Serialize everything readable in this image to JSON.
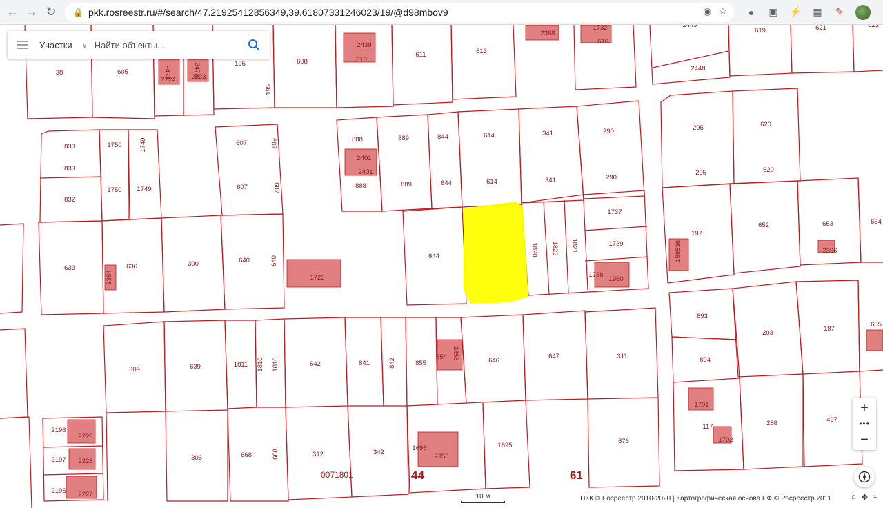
{
  "browser": {
    "url": "pkk.rosreestr.ru/#/search/47.21925412856349,39.61807331246023/19/@d98mbov9"
  },
  "search": {
    "layer_label": "Участки",
    "placeholder": "Найти объекты..."
  },
  "map": {
    "quarter_label": "0071801",
    "district_44": "44",
    "district_61": "61",
    "scale_label": "10 м",
    "copyright": "ПКК © Росреестр 2010-2020 | Картографическая основа РФ © Росреестр 2011",
    "parcel_color": "#c8161d",
    "building_color": "#e08080",
    "highlight_color": "#ffff00",
    "parcels": [
      {
        "id": "619"
      },
      {
        "id": "621"
      },
      {
        "id": "623"
      },
      {
        "id": "2449"
      },
      {
        "id": "2448"
      },
      {
        "id": "38"
      },
      {
        "id": "605"
      },
      {
        "id": "2224"
      },
      {
        "id": "2223"
      },
      {
        "id": "195"
      },
      {
        "id": "608"
      },
      {
        "id": "2439"
      },
      {
        "id": "810"
      },
      {
        "id": "611"
      },
      {
        "id": "613"
      },
      {
        "id": "2388"
      },
      {
        "id": "1732"
      },
      {
        "id": "616"
      },
      {
        "id": "888"
      },
      {
        "id": "889"
      },
      {
        "id": "844"
      },
      {
        "id": "614"
      },
      {
        "id": "341"
      },
      {
        "id": "290"
      },
      {
        "id": "295"
      },
      {
        "id": "620"
      },
      {
        "id": "2401"
      },
      {
        "id": "833"
      },
      {
        "id": "1750"
      },
      {
        "id": "1749"
      },
      {
        "id": "607"
      },
      {
        "id": "832"
      },
      {
        "id": "1737"
      },
      {
        "id": "1739"
      },
      {
        "id": "1738"
      },
      {
        "id": "1960"
      },
      {
        "id": "1820"
      },
      {
        "id": "1822"
      },
      {
        "id": "1821"
      },
      {
        "id": "633"
      },
      {
        "id": "636"
      },
      {
        "id": "2364"
      },
      {
        "id": "300"
      },
      {
        "id": "640"
      },
      {
        "id": "1723"
      },
      {
        "id": "644"
      },
      {
        "id": "197"
      },
      {
        "id": "159536"
      },
      {
        "id": "652"
      },
      {
        "id": "653"
      },
      {
        "id": "2396"
      },
      {
        "id": "654"
      },
      {
        "id": "309"
      },
      {
        "id": "639"
      },
      {
        "id": "1811"
      },
      {
        "id": "1810"
      },
      {
        "id": "642"
      },
      {
        "id": "841"
      },
      {
        "id": "842"
      },
      {
        "id": "855"
      },
      {
        "id": "854"
      },
      {
        "id": "1858"
      },
      {
        "id": "646"
      },
      {
        "id": "647"
      },
      {
        "id": "311"
      },
      {
        "id": "893"
      },
      {
        "id": "203"
      },
      {
        "id": "187"
      },
      {
        "id": "655"
      },
      {
        "id": "894"
      },
      {
        "id": "2196"
      },
      {
        "id": "2229"
      },
      {
        "id": "2197"
      },
      {
        "id": "2228"
      },
      {
        "id": "2195"
      },
      {
        "id": "2227"
      },
      {
        "id": "306"
      },
      {
        "id": "668"
      },
      {
        "id": "312"
      },
      {
        "id": "342"
      },
      {
        "id": "1696"
      },
      {
        "id": "2356"
      },
      {
        "id": "1695"
      },
      {
        "id": "676"
      },
      {
        "id": "1701"
      },
      {
        "id": "117"
      },
      {
        "id": "1702"
      },
      {
        "id": "288"
      },
      {
        "id": "497"
      }
    ]
  }
}
